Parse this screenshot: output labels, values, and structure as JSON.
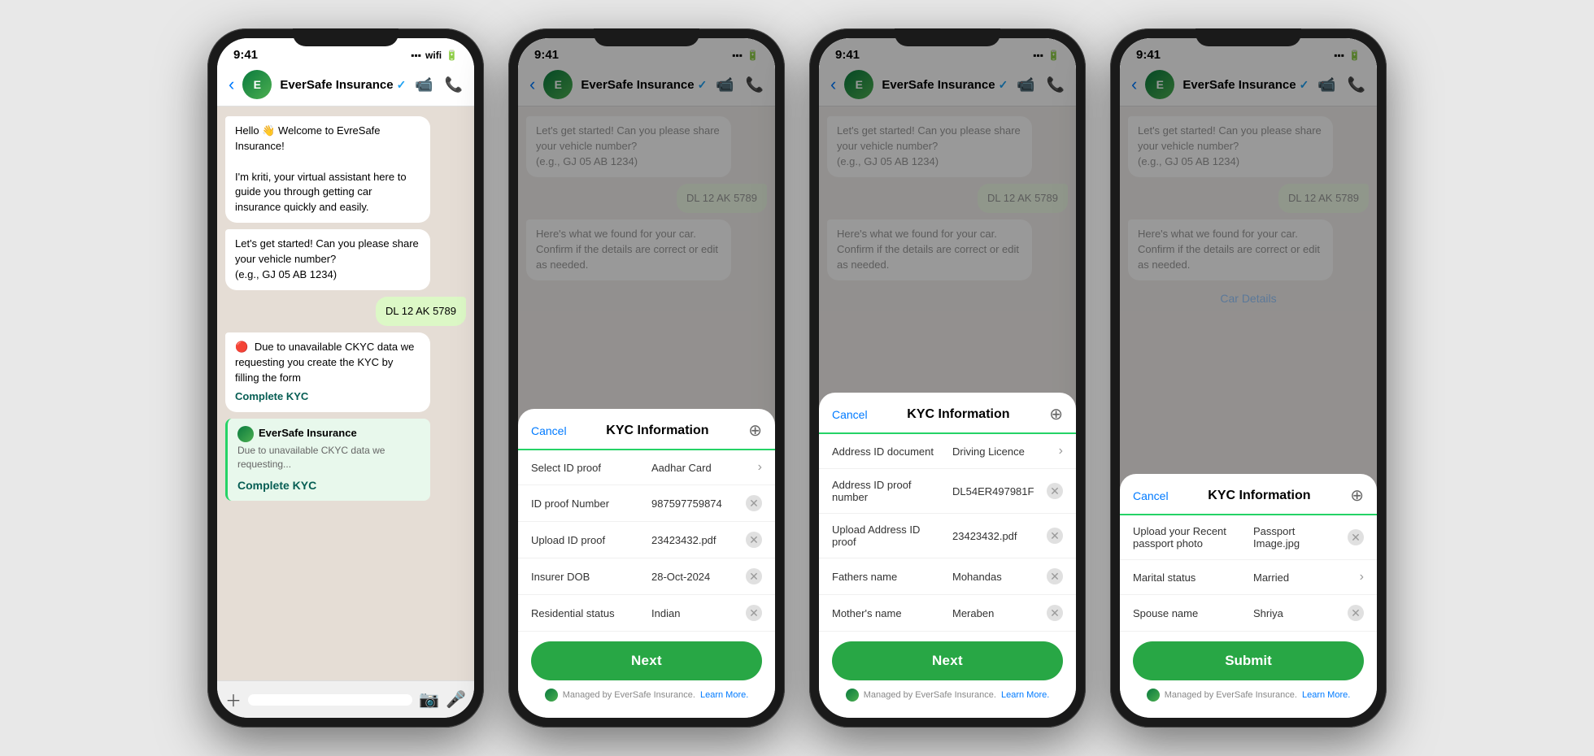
{
  "phones": [
    {
      "id": "phone1",
      "status_time": "9:41",
      "app_name": "EverSafe Insurance",
      "chat_messages": [
        {
          "type": "received",
          "text": "Hello 👋 Welcome to EvreSafe Insurance!\n\nI'm kriti, your virtual assistant here to guide you through getting car insurance quickly and easily."
        },
        {
          "type": "received",
          "text": "Let's get started! Can you please share your vehicle number?\n(e.g., GJ 05 AB 1234)"
        },
        {
          "type": "sent",
          "text": "DL 12 AK 5789"
        },
        {
          "type": "error",
          "text": "Due to unavailable CKYC data we requesting you create the KYC by filling the form"
        },
        {
          "type": "link",
          "text": "Complete KYC"
        },
        {
          "type": "notification",
          "title": "EverSafe Insurance",
          "subtitle": "Due to unavailable CKYC data we requesting...",
          "action": "Complete KYC"
        }
      ]
    },
    {
      "id": "phone2",
      "status_time": "9:41",
      "app_name": "EverSafe Insurance",
      "chat_messages": [
        {
          "type": "received",
          "text": "Let's get started! Can you please share your vehicle number?\n(e.g., GJ 05 AB 1234)"
        },
        {
          "type": "sent",
          "text": "DL 12 AK 5789"
        },
        {
          "type": "received",
          "text": "Here's what we found for your car. Confirm if the details are correct or edit as needed."
        }
      ],
      "modal": {
        "title": "KYC Information",
        "cancel": "Cancel",
        "more": "⊕",
        "rows": [
          {
            "label": "Select ID proof",
            "value": "Aadhar Card",
            "type": "chevron"
          },
          {
            "label": "ID proof Number",
            "value": "987597759874",
            "type": "clear"
          },
          {
            "label": "Upload ID proof",
            "value": "23423432.pdf",
            "type": "clear"
          },
          {
            "label": "Insurer DOB",
            "value": "28-Oct-2024",
            "type": "clear"
          },
          {
            "label": "Residential status",
            "value": "Indian",
            "type": "clear"
          }
        ],
        "button": "Next"
      }
    },
    {
      "id": "phone3",
      "status_time": "9:41",
      "app_name": "EverSafe Insurance",
      "chat_messages": [
        {
          "type": "received",
          "text": "Let's get started! Can you please share your vehicle number?\n(e.g., GJ 05 AB 1234)"
        },
        {
          "type": "sent",
          "text": "DL 12 AK 5789"
        },
        {
          "type": "received",
          "text": "Here's what we found for your car. Confirm if the details are correct or edit as needed."
        }
      ],
      "modal": {
        "title": "KYC Information",
        "cancel": "Cancel",
        "more": "⊕",
        "rows": [
          {
            "label": "Address ID document",
            "value": "Driving Licence",
            "type": "chevron"
          },
          {
            "label": "Address ID proof number",
            "value": "DL54ER497981F",
            "type": "clear"
          },
          {
            "label": "Upload Address ID proof",
            "value": "23423432.pdf",
            "type": "clear"
          },
          {
            "label": "Fathers name",
            "value": "Mohandas",
            "type": "clear"
          },
          {
            "label": "Mother's name",
            "value": "Meraben",
            "type": "clear"
          }
        ],
        "button": "Next"
      }
    },
    {
      "id": "phone4",
      "status_time": "9:41",
      "app_name": "EverSafe Insurance",
      "chat_messages": [
        {
          "type": "received",
          "text": "Let's get started! Can you please share your vehicle number?\n(e.g., GJ 05 AB 1234)"
        },
        {
          "type": "sent",
          "text": "DL 12 AK 5789"
        },
        {
          "type": "received",
          "text": "Here's what we found for your car. Confirm if the details are correct or edit as needed."
        },
        {
          "type": "car-details-link"
        }
      ],
      "modal": {
        "title": "KYC Information",
        "cancel": "Cancel",
        "more": "⊕",
        "rows": [
          {
            "label": "Upload your Recent passport photo",
            "value": "Passport Image.jpg",
            "type": "clear"
          },
          {
            "label": "Marital status",
            "value": "Married",
            "type": "chevron"
          },
          {
            "label": "Spouse name",
            "value": "Shriya",
            "type": "clear"
          }
        ],
        "button": "Submit"
      }
    }
  ],
  "managed_text": "Managed by EverSafe Insurance.",
  "learn_more": "Learn More."
}
